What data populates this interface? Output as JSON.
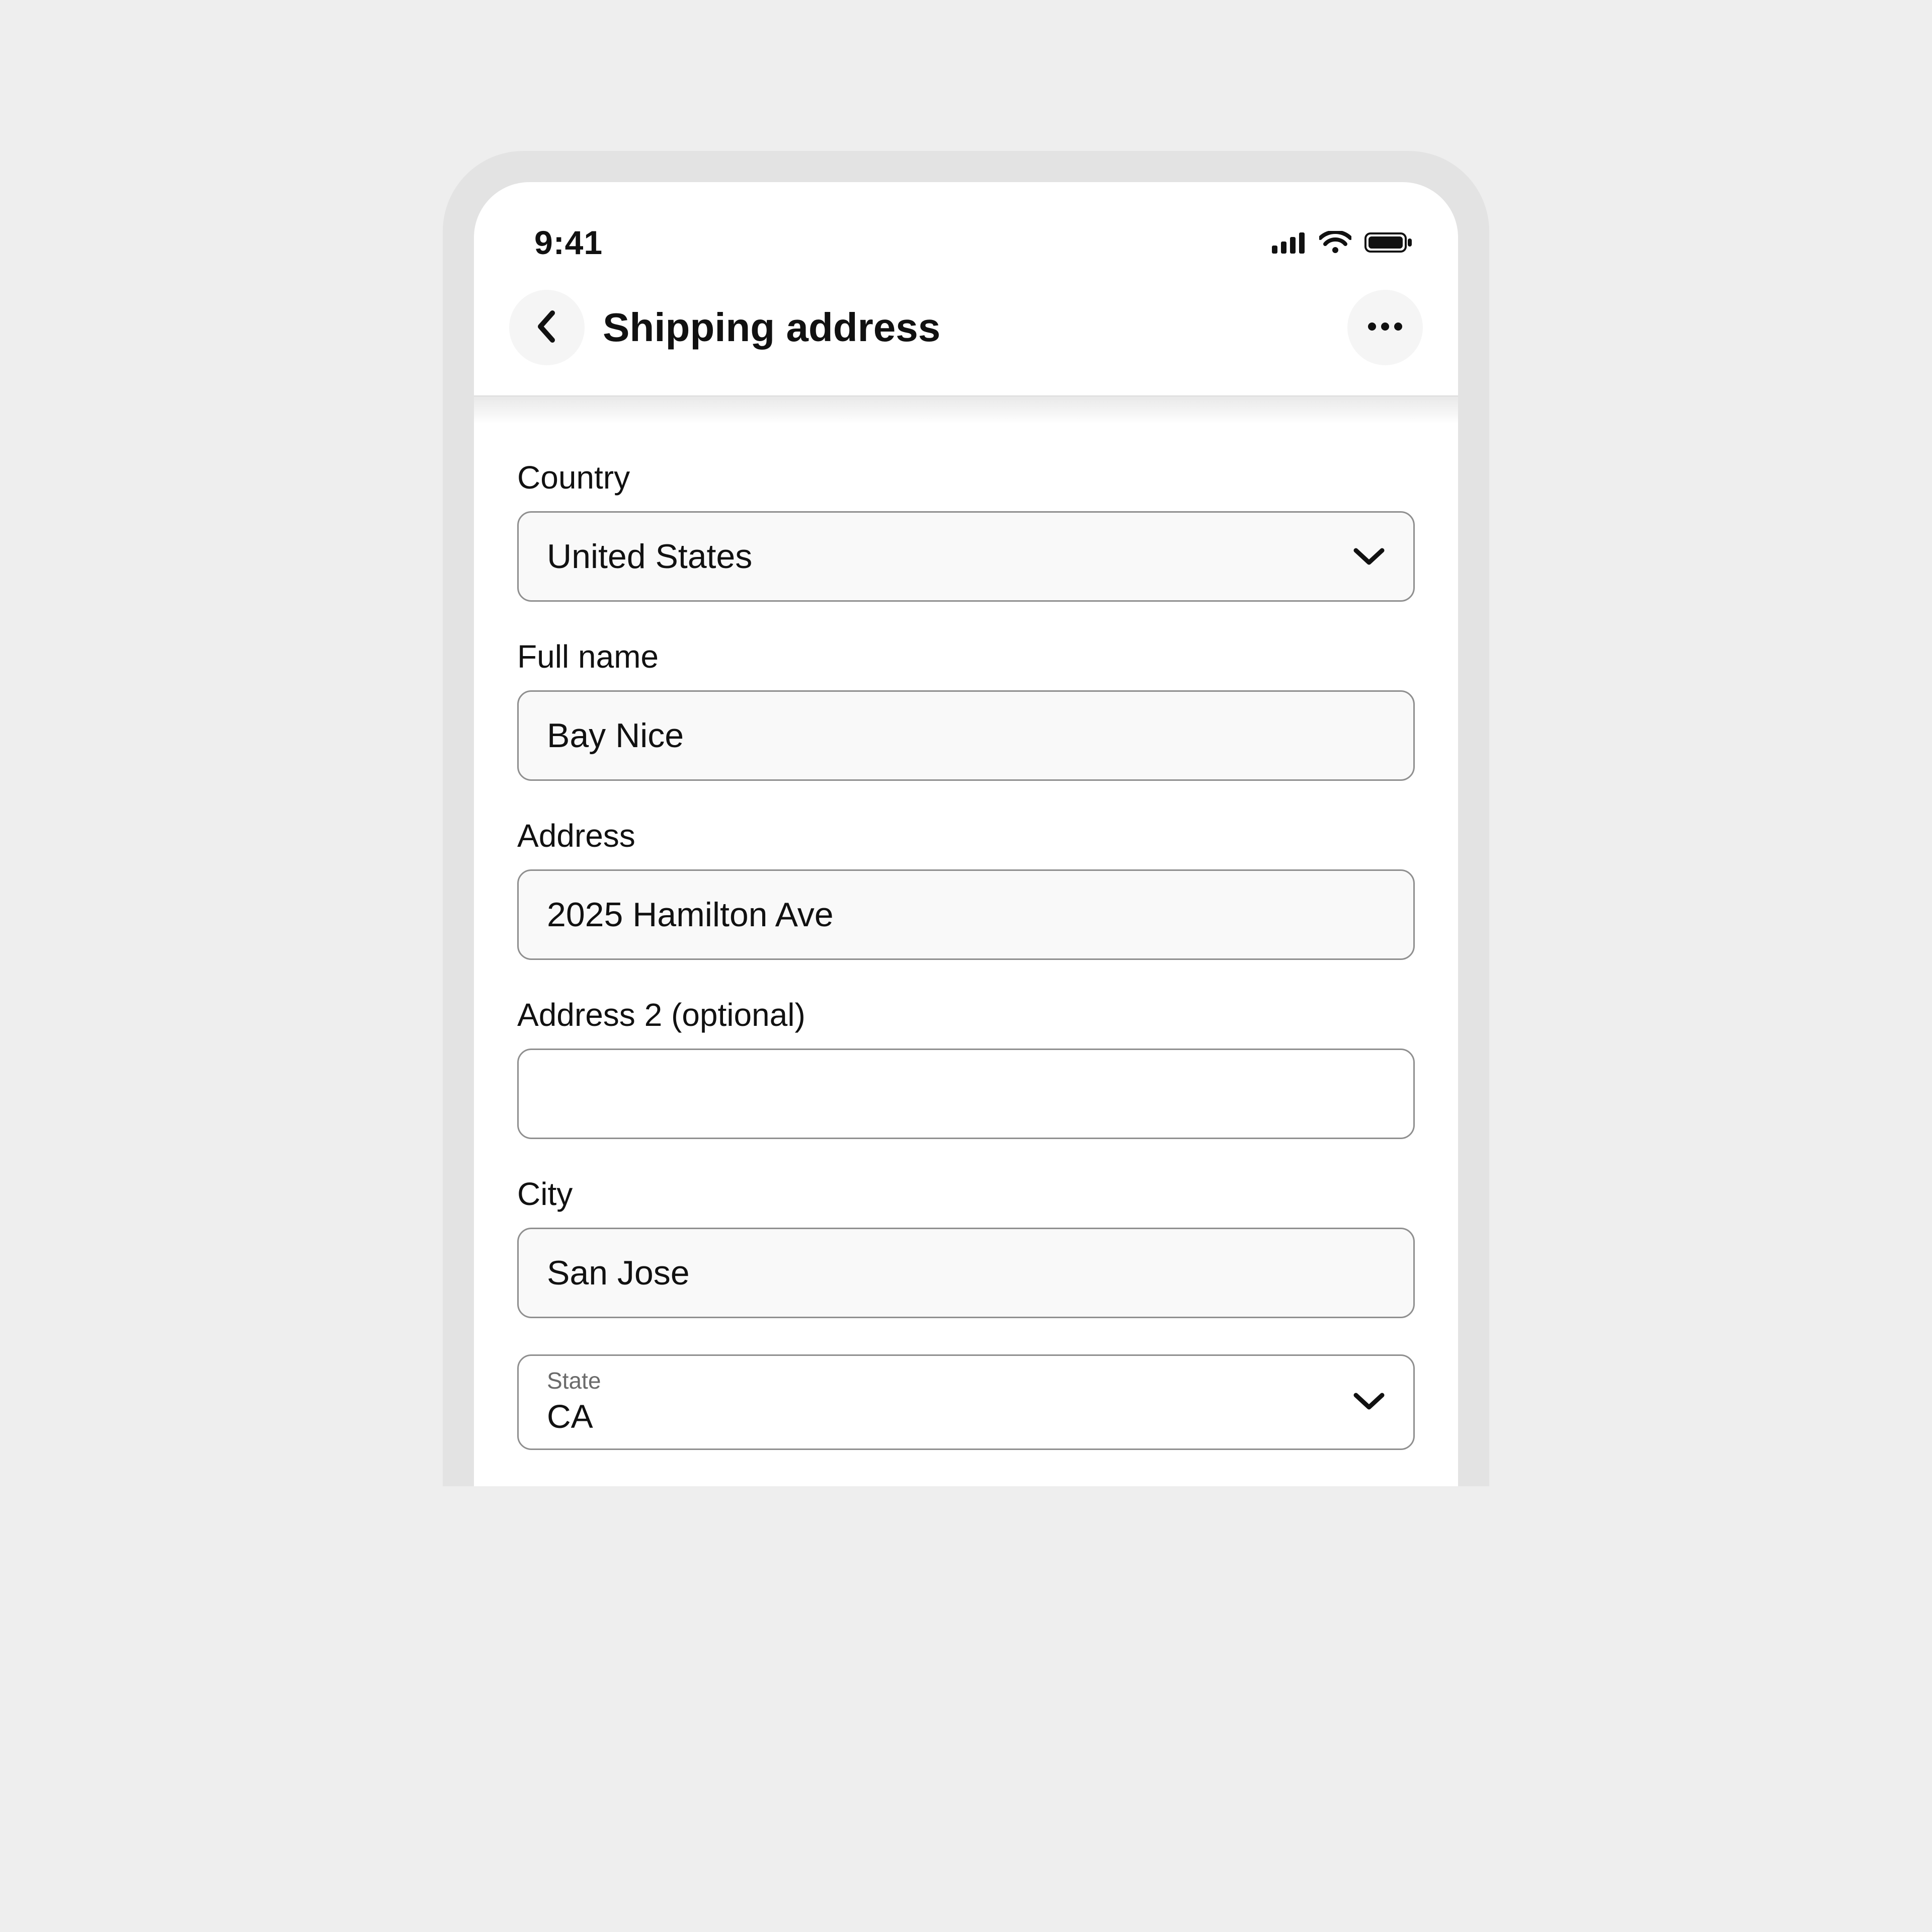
{
  "status": {
    "time": "9:41"
  },
  "header": {
    "title": "Shipping address"
  },
  "form": {
    "country": {
      "label": "Country",
      "value": "United States"
    },
    "full_name": {
      "label": "Full name",
      "value": "Bay Nice"
    },
    "address": {
      "label": "Address",
      "value": "2025 Hamilton Ave"
    },
    "address2": {
      "label": "Address 2 (optional)",
      "value": ""
    },
    "city": {
      "label": "City",
      "value": "San Jose"
    },
    "state": {
      "label": "State",
      "value": "CA"
    }
  }
}
